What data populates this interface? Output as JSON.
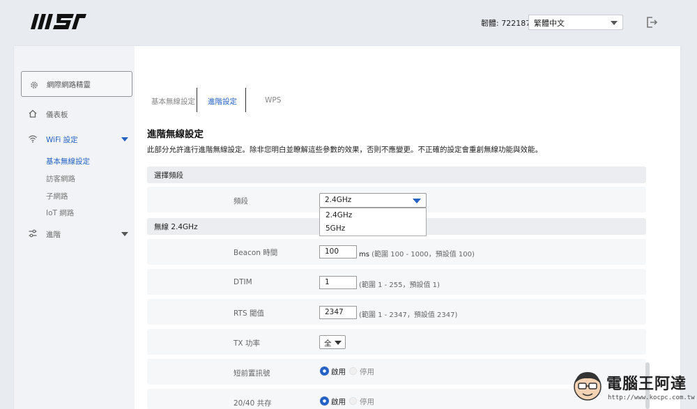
{
  "header": {
    "logo_text": "MSI",
    "firmware_label": "韌體: 722187",
    "language": "繁體中文"
  },
  "sidebar": {
    "wizard": "網際網路精靈",
    "items": [
      {
        "label": "儀表板"
      },
      {
        "label": "WiFi 設定"
      },
      {
        "label": "進階"
      }
    ],
    "wifi_sub": [
      "基本無線設定",
      "訪客網路",
      "子網路",
      "IoT 網路"
    ]
  },
  "tabs": [
    "基本無線設定",
    "進階設定",
    "WPS"
  ],
  "content": {
    "title": "進階無線設定",
    "description": "此部分允許進行進階無線設定。除非您明白並瞭解這些參數的效果，否則不應變更。不正確的設定會重創無線功能與效能。",
    "section_band": "選擇頻段",
    "band_label": "頻段",
    "band_value": "2.4GHz",
    "band_options": [
      "2.4GHz",
      "5GHz"
    ],
    "section_wireless": "無線 2.4GHz",
    "beacon_label": "Beacon 時間",
    "beacon_value": "100",
    "beacon_unit": "ms",
    "beacon_hint": "(範圍 100 - 1000，預設值 100)",
    "dtim_label": "DTIM",
    "dtim_value": "1",
    "dtim_hint": "(範圍 1 - 255，預設值 1)",
    "rts_label": "RTS 閾值",
    "rts_value": "2347",
    "rts_hint": "(範圍 1 - 2347，預設值 2347)",
    "tx_label": "TX 功率",
    "tx_value": "全",
    "preamble_label": "短前置訊號",
    "coexist_label": "20/40 共存",
    "enable": "啟用",
    "disable": "停用"
  },
  "watermark": {
    "brand": "電腦王阿達",
    "url": "http://www.kocpc.com.tw"
  },
  "colors": {
    "accent": "#2461c4",
    "page_bg": "#e8ebf0",
    "row_bg": "#f6f7f9",
    "section_bg": "#ecedf0"
  }
}
